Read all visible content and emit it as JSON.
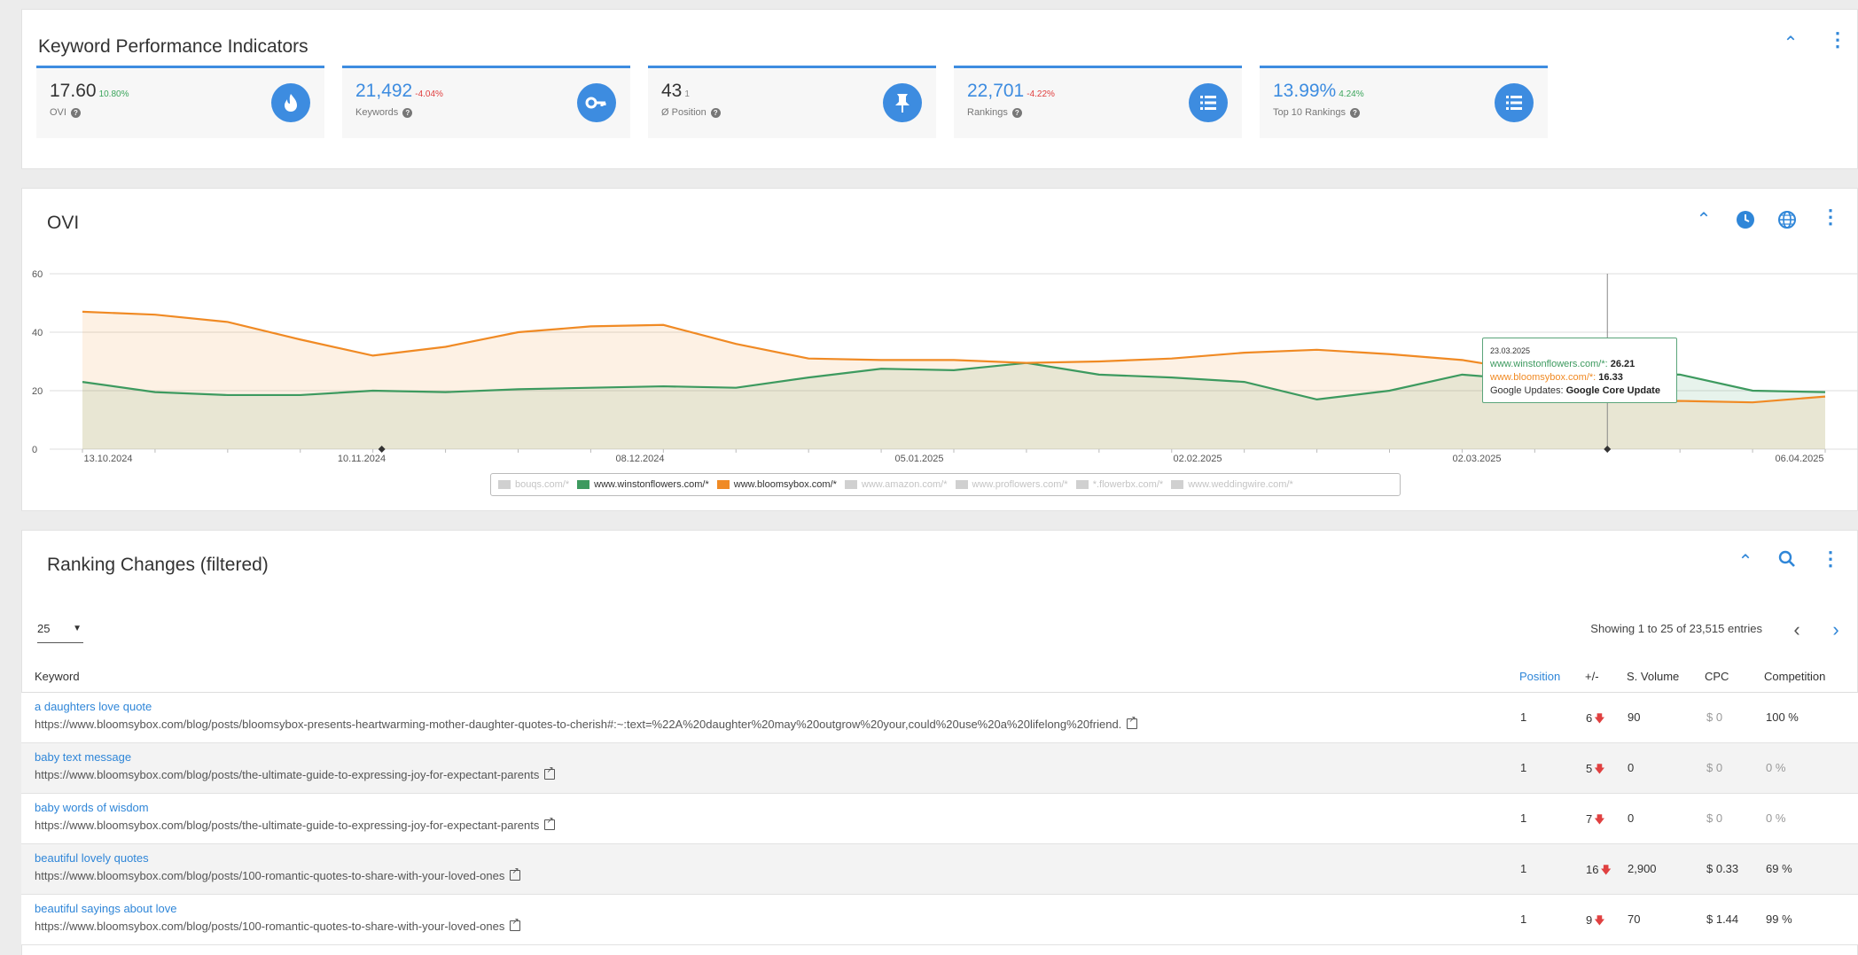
{
  "kpi_section": {
    "title": "Keyword Performance Indicators",
    "cards": [
      {
        "value": "17.60",
        "change": "10.80%",
        "change_type": "pos",
        "label": "OVI",
        "icon": "flame-icon",
        "blue": false
      },
      {
        "value": "21,492",
        "change": "-4.04%",
        "change_type": "neg",
        "label": "Keywords",
        "icon": "key-icon",
        "blue": true
      },
      {
        "value": "43",
        "change": "1",
        "change_type": "neu",
        "label": "Ø Position",
        "icon": "pin-icon",
        "blue": false
      },
      {
        "value": "22,701",
        "change": "-4.22%",
        "change_type": "neg",
        "label": "Rankings",
        "icon": "list-icon",
        "blue": true
      },
      {
        "value": "13.99%",
        "change": "4.24%",
        "change_type": "pos",
        "label": "Top 10 Rankings",
        "icon": "list-icon",
        "blue": true
      }
    ]
  },
  "ovi_section": {
    "title": "OVI"
  },
  "chart_data": {
    "type": "area",
    "title": "OVI",
    "x_labels": [
      "13.10.2024",
      "10.11.2024",
      "08.12.2024",
      "05.01.2025",
      "02.02.2025",
      "02.03.2025",
      "06.04.2025"
    ],
    "ylim": [
      0,
      60
    ],
    "y_ticks": [
      0,
      20,
      40,
      60
    ],
    "grid": true,
    "legend_position": "bottom",
    "series": [
      {
        "name": "bouqs.com/*",
        "color": "#c8c8c8",
        "visible": false,
        "values": []
      },
      {
        "name": "www.winstonflowers.com/*",
        "color": "#3d9a5f",
        "visible": true,
        "values": [
          23.0,
          19.5,
          18.5,
          18.5,
          20.0,
          19.5,
          20.5,
          21.0,
          21.5,
          21.0,
          24.5,
          27.5,
          27.0,
          29.5,
          25.5,
          24.5,
          23.0,
          17.0,
          20.0,
          25.5,
          23.5,
          26.21,
          25.5,
          20.0,
          19.5
        ]
      },
      {
        "name": "www.bloomsybox.com/*",
        "color": "#f08a24",
        "visible": true,
        "values": [
          47.0,
          46.0,
          43.5,
          37.5,
          32.0,
          35.0,
          40.0,
          42.0,
          42.5,
          36.0,
          31.0,
          30.5,
          30.5,
          29.5,
          30.0,
          31.0,
          33.0,
          34.0,
          32.5,
          30.5,
          26.5,
          16.33,
          16.5,
          16.0,
          18.0
        ]
      },
      {
        "name": "www.amazon.com/*",
        "color": "#c8c8c8",
        "visible": false,
        "values": []
      },
      {
        "name": "www.proflowers.com/*",
        "color": "#c8c8c8",
        "visible": false,
        "values": []
      },
      {
        "name": "*.flowerbx.com/*",
        "color": "#c8c8c8",
        "visible": false,
        "values": []
      },
      {
        "name": "www.weddingwire.com/*",
        "color": "#c8c8c8",
        "visible": false,
        "values": []
      }
    ],
    "tooltip": {
      "date": "23.03.2025",
      "winston_label": "www.winstonflowers.com/*:",
      "winston_value": "26.21",
      "bloomsy_label": "www.bloomsybox.com/*:",
      "bloomsy_value": "16.33",
      "updates_label": "Google Updates:",
      "updates_value": "Google Core Update"
    }
  },
  "ranking_section": {
    "title": "Ranking Changes (filtered)",
    "rows_per_page": "25",
    "showing": "Showing 1 to 25 of 23,515 entries",
    "columns": {
      "keyword": "Keyword",
      "position": "Position",
      "change": "+/-",
      "volume": "S. Volume",
      "cpc": "CPC",
      "competition": "Competition"
    },
    "rows": [
      {
        "keyword": "a daughters love quote",
        "url": "https://www.bloomsybox.com/blog/posts/bloomsybox-presents-heartwarming-mother-daughter-quotes-to-cherish#:~:text=%22A%20daughter%20may%20outgrow%20your,could%20use%20a%20lifelong%20friend.",
        "position": "1",
        "change": "6",
        "volume": "90",
        "cpc": "$ 0",
        "cpc_muted": true,
        "competition": "100 %",
        "comp_muted": false
      },
      {
        "keyword": "baby text message",
        "url": "https://www.bloomsybox.com/blog/posts/the-ultimate-guide-to-expressing-joy-for-expectant-parents",
        "position": "1",
        "change": "5",
        "volume": "0",
        "cpc": "$ 0",
        "cpc_muted": true,
        "competition": "0 %",
        "comp_muted": true
      },
      {
        "keyword": "baby words of wisdom",
        "url": "https://www.bloomsybox.com/blog/posts/the-ultimate-guide-to-expressing-joy-for-expectant-parents",
        "position": "1",
        "change": "7",
        "volume": "0",
        "cpc": "$ 0",
        "cpc_muted": true,
        "competition": "0 %",
        "comp_muted": true
      },
      {
        "keyword": "beautiful lovely quotes",
        "url": "https://www.bloomsybox.com/blog/posts/100-romantic-quotes-to-share-with-your-loved-ones",
        "position": "1",
        "change": "16",
        "volume": "2,900",
        "cpc": "$ 0.33",
        "cpc_muted": false,
        "competition": "69 %",
        "comp_muted": false
      },
      {
        "keyword": "beautiful sayings about love",
        "url": "https://www.bloomsybox.com/blog/posts/100-romantic-quotes-to-share-with-your-loved-ones",
        "position": "1",
        "change": "9",
        "volume": "70",
        "cpc": "$ 1.44",
        "cpc_muted": false,
        "competition": "99 %",
        "comp_muted": false
      }
    ]
  },
  "colors": {
    "accent": "#2f86d8",
    "kpi_circle": "#3d8ce0",
    "positive": "#3ba55c",
    "negative": "#e04040"
  }
}
